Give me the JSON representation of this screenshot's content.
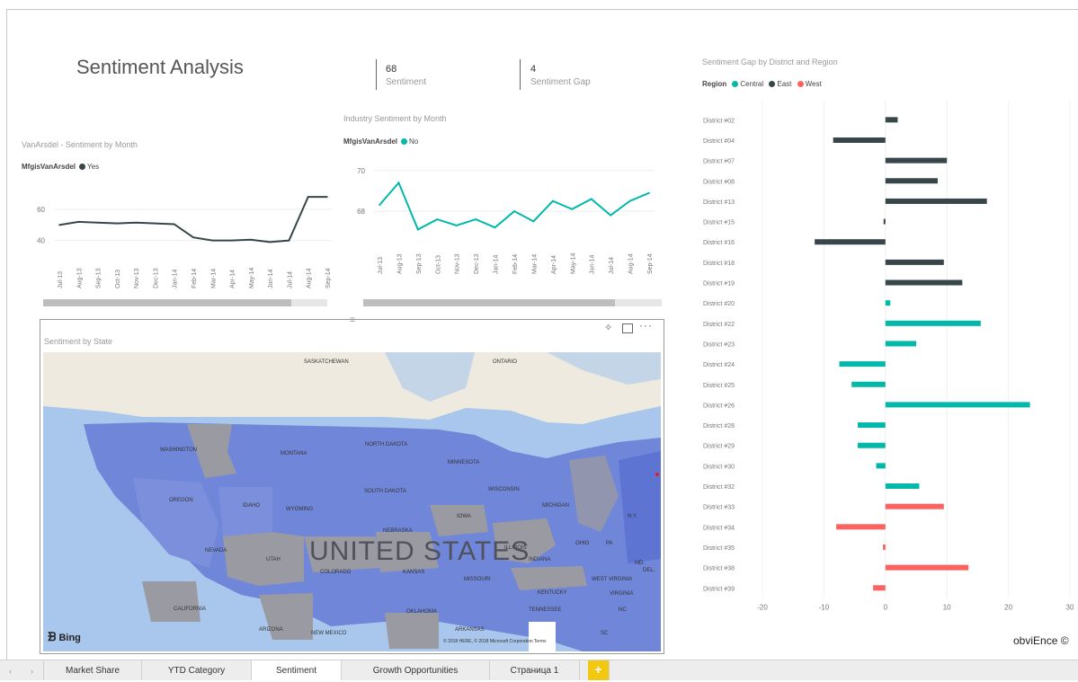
{
  "report": {
    "title": "Sentiment Analysis",
    "footer_brand": "obviEnce ©"
  },
  "kpis": [
    {
      "value": "68",
      "label": "Sentiment"
    },
    {
      "value": "4",
      "label": "Sentiment Gap"
    }
  ],
  "charts": {
    "vanarsdel": {
      "title": "VanArsdel - Sentiment by Month",
      "legend_title": "MfgisVanArsdel",
      "legend_item": "Yes",
      "color": "#374649"
    },
    "industry": {
      "title": "Industry Sentiment by Month",
      "legend_title": "MfgisVanArsdel",
      "legend_item": "No",
      "color": "#01b8aa"
    },
    "gap": {
      "title": "Sentiment Gap by District and Region",
      "legend_title": "Region",
      "regions": [
        {
          "name": "Central",
          "color": "#01b8aa"
        },
        {
          "name": "East",
          "color": "#374649"
        },
        {
          "name": "West",
          "color": "#fd625e"
        }
      ]
    }
  },
  "map": {
    "title": "Sentiment by State",
    "bing_label": "Bing",
    "country_label": "UNITED STATES",
    "copyright": "© 2018 HERE, © 2018 Microsoft Corporation  Terms",
    "labels": {
      "saskatchewan": "SASKATCHEWAN",
      "ontario": "ONTARIO",
      "washington": "WASHINGTON",
      "montana": "MONTANA",
      "north_dakota": "NORTH DAKOTA",
      "minnesota": "MINNESOTA",
      "oregon": "OREGON",
      "idaho": "IDAHO",
      "south_dakota": "SOUTH DAKOTA",
      "wisconsin": "WISCONSIN",
      "michigan": "MICHIGAN",
      "wyoming": "WYOMING",
      "iowa": "IOWA",
      "nebraska": "NEBRASKA",
      "nevada": "NEVADA",
      "utah": "UTAH",
      "colorado": "COLORADO",
      "kansas": "KANSAS",
      "missouri": "MISSOURI",
      "illinois": "ILLINOIS",
      "indiana": "INDIANA",
      "ohio": "OHIO",
      "pa": "PA",
      "ny": "N.Y.",
      "kentucky": "KENTUCKY",
      "virginia": "VIRGINIA",
      "west_virginia": "WEST VIRGINIA",
      "md": "MD.",
      "del": "DEL.",
      "california": "CALIFORNIA",
      "arizona": "ARIZONA",
      "new_mexico": "NEW MEXICO",
      "oklahoma": "OKLAHOMA",
      "arkansas": "ARKANSAS",
      "tennessee": "TENNESSEE",
      "nc": "NC",
      "sc": "SC"
    },
    "toolbar": {
      "pin": "pin-icon",
      "focus": "focus-mode-icon",
      "more": "more-options-icon"
    }
  },
  "tabs": [
    {
      "label": "Market Share",
      "active": false
    },
    {
      "label": "YTD Category",
      "active": false
    },
    {
      "label": "Sentiment",
      "active": true
    },
    {
      "label": "Growth Opportunities",
      "active": false
    },
    {
      "label": "Страница 1",
      "active": false
    }
  ],
  "add_tab_label": "+",
  "chart_data": [
    {
      "type": "line",
      "title": "VanArsdel - Sentiment by Month",
      "legend": [
        {
          "name": "Yes",
          "color": "#374649"
        }
      ],
      "x": [
        "Jul-13",
        "Aug-13",
        "Sep-13",
        "Oct-13",
        "Nov-13",
        "Dec-13",
        "Jan-14",
        "Feb-14",
        "Mar-14",
        "Apr-14",
        "May-14",
        "Jun-14",
        "Jul-14",
        "Aug-14",
        "Sep-14"
      ],
      "series": [
        {
          "name": "Yes",
          "values": [
            50,
            52,
            51.5,
            51,
            51.5,
            51,
            50.5,
            42,
            40,
            40,
            40.5,
            39,
            40,
            68,
            68
          ]
        }
      ],
      "ylim": [
        30,
        75
      ],
      "yticks": [
        40,
        60
      ]
    },
    {
      "type": "line",
      "title": "Industry Sentiment by Month",
      "legend": [
        {
          "name": "No",
          "color": "#01b8aa"
        }
      ],
      "x": [
        "Jul-13",
        "Aug-13",
        "Sep-13",
        "Oct-13",
        "Nov-13",
        "Dec-13",
        "Jan-14",
        "Feb-14",
        "Mar-14",
        "Apr-14",
        "May-14",
        "Jun-14",
        "Jul-14",
        "Aug-14",
        "Sep-14"
      ],
      "series": [
        {
          "name": "No",
          "values": [
            68.3,
            69.4,
            67.1,
            67.6,
            67.3,
            67.6,
            67.2,
            68.0,
            67.5,
            68.5,
            68.1,
            68.6,
            67.8,
            68.5,
            68.9
          ]
        }
      ],
      "ylim": [
        66.5,
        70.3
      ],
      "yticks": [
        68,
        70
      ]
    },
    {
      "type": "bar",
      "orientation": "horizontal",
      "title": "Sentiment Gap by District and Region",
      "categories": [
        "District #02",
        "District #04",
        "District #07",
        "District #08",
        "District #13",
        "District #15",
        "District #16",
        "District #18",
        "District #19",
        "District #20",
        "District #22",
        "District #23",
        "District #24",
        "District #25",
        "District #26",
        "District #28",
        "District #29",
        "District #30",
        "District #32",
        "District #33",
        "District #34",
        "District #35",
        "District #38",
        "District #39"
      ],
      "values": [
        2,
        -8.5,
        10,
        8.5,
        16.5,
        -0.3,
        -11.5,
        9.5,
        12.5,
        0.8,
        15.5,
        5,
        -7.5,
        -5.5,
        23.5,
        -4.5,
        -4.5,
        -1.5,
        5.5,
        9.5,
        -8,
        -0.4,
        13.5,
        -2
      ],
      "regions": [
        "East",
        "East",
        "East",
        "East",
        "East",
        "East",
        "East",
        "East",
        "East",
        "Central",
        "Central",
        "Central",
        "Central",
        "Central",
        "Central",
        "Central",
        "Central",
        "Central",
        "Central",
        "West",
        "West",
        "West",
        "West",
        "West"
      ],
      "xlim": [
        -20,
        30
      ],
      "xticks": [
        -20,
        -10,
        0,
        10,
        20,
        30
      ]
    }
  ]
}
